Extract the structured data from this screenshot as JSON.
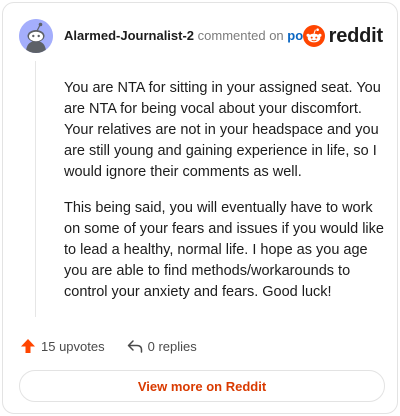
{
  "comment": {
    "author": "Alarmed-Journalist-2",
    "action_text": "commented on",
    "post_link": "post",
    "paragraphs": [
      "You are NTA for sitting in your assigned seat. You are NTA for being vocal about your discomfort. Your relatives are not in your headspace and you are still young and gaining experience in life, so I would ignore their comments as well.",
      "This being said, you will eventually have to work on some of your fears and issues if you would like to lead a healthy, normal life. I hope as you age you are able to find methods/workarounds to control your anxiety and fears. Good luck!"
    ]
  },
  "brand": {
    "name": "reddit",
    "icon": "reddit-logo-icon",
    "color": "#ff4500"
  },
  "actions": {
    "upvotes": "15 upvotes",
    "upvote_icon": "upvote-arrow-icon",
    "replies": "0 replies",
    "reply_icon": "reply-arrow-icon"
  },
  "footer": {
    "view_more": "View more on Reddit"
  },
  "colors": {
    "accent": "#d93a00",
    "upvote": "#ff4500",
    "link": "#0a66c2",
    "avatar_bg": "#a4aefc"
  }
}
